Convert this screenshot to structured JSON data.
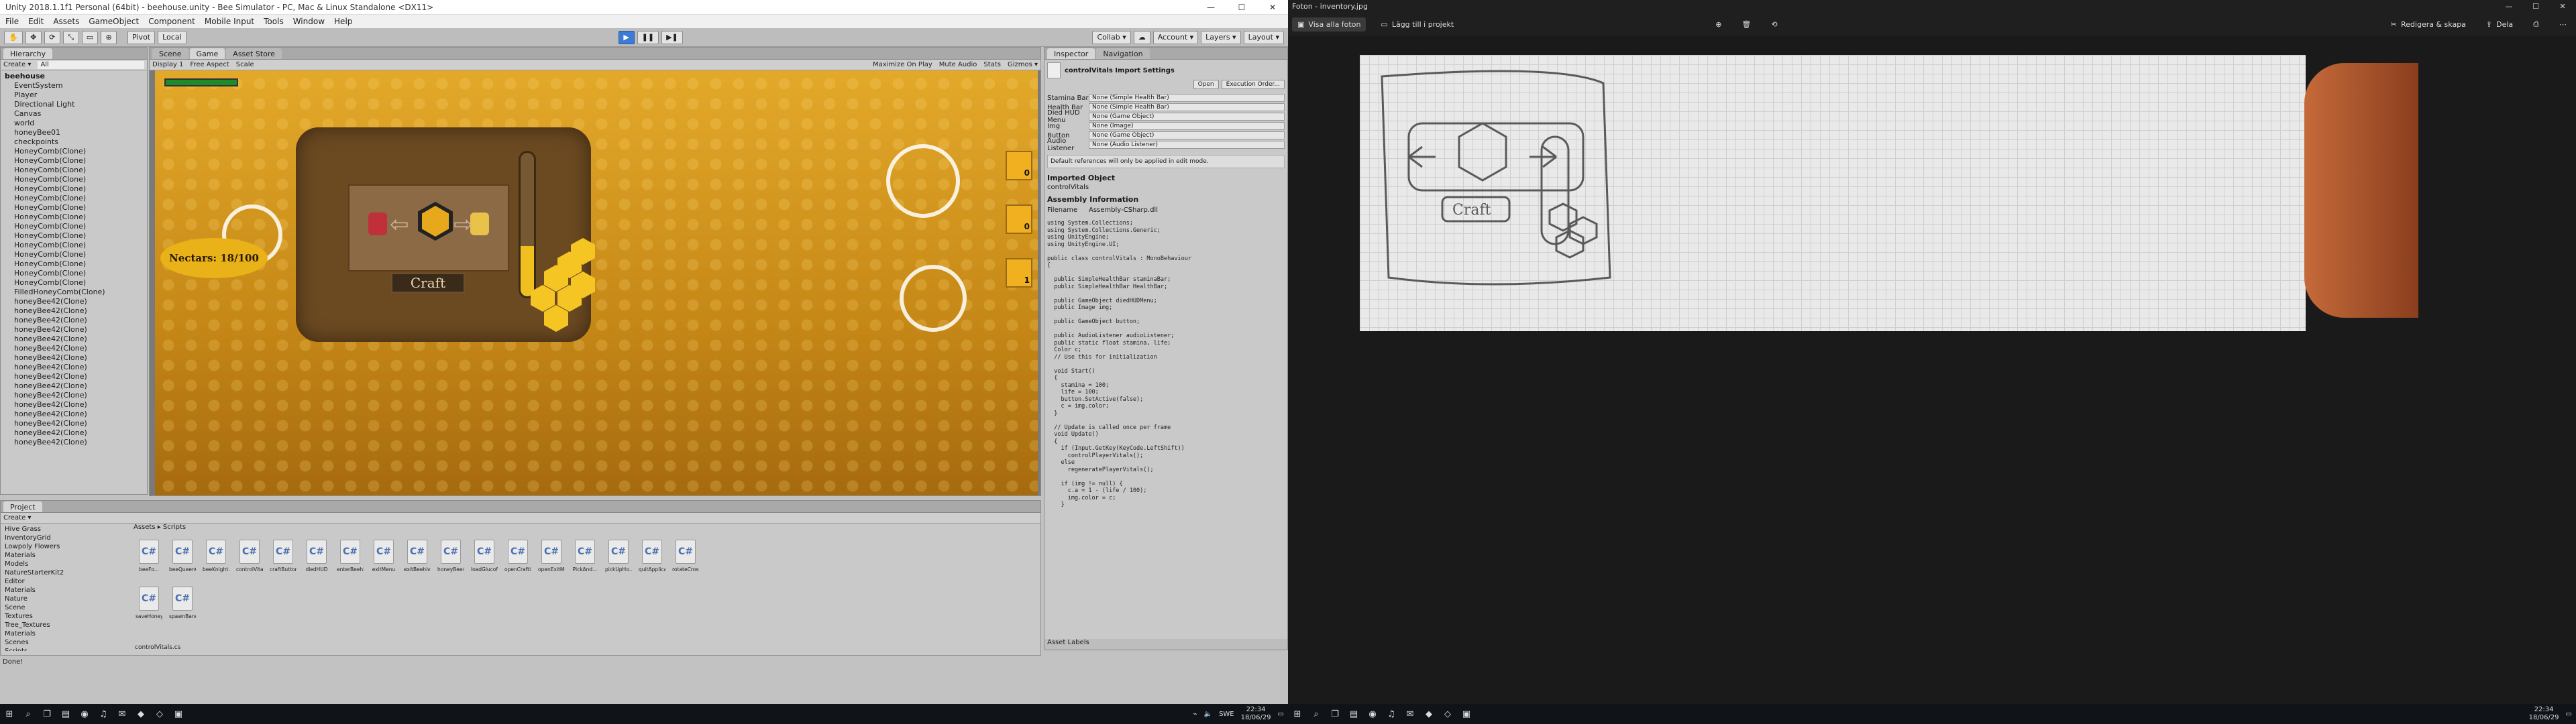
{
  "unity": {
    "title": "Unity 2018.1.1f1 Personal (64bit) - beehouse.unity - Bee Simulator - PC, Mac & Linux Standalone <DX11>",
    "menu": [
      "File",
      "Edit",
      "Assets",
      "GameObject",
      "Component",
      "Mobile Input",
      "Tools",
      "Window",
      "Help"
    ],
    "toolbar": {
      "pivot": "Pivot",
      "local": "Local",
      "collab": "Collab ▾",
      "account": "Account ▾",
      "layers": "Layers ▾",
      "layout": "Layout ▾"
    },
    "hierarchy": {
      "tab": "Hierarchy",
      "create": "Create ▾",
      "search": "All",
      "scene": "beehouse",
      "items": [
        "EventSystem",
        "Player",
        "Directional Light",
        "Canvas",
        "world",
        "honeyBee01",
        "checkpoints",
        "HoneyComb(Clone)",
        "HoneyComb(Clone)",
        "HoneyComb(Clone)",
        "HoneyComb(Clone)",
        "HoneyComb(Clone)",
        "HoneyComb(Clone)",
        "HoneyComb(Clone)",
        "HoneyComb(Clone)",
        "HoneyComb(Clone)",
        "HoneyComb(Clone)",
        "HoneyComb(Clone)",
        "HoneyComb(Clone)",
        "HoneyComb(Clone)",
        "HoneyComb(Clone)",
        "HoneyComb(Clone)",
        "FilledHoneyComb(Clone)",
        "honeyBee42(Clone)",
        "honeyBee42(Clone)",
        "honeyBee42(Clone)",
        "honeyBee42(Clone)",
        "honeyBee42(Clone)",
        "honeyBee42(Clone)",
        "honeyBee42(Clone)",
        "honeyBee42(Clone)",
        "honeyBee42(Clone)",
        "honeyBee42(Clone)",
        "honeyBee42(Clone)",
        "honeyBee42(Clone)",
        "honeyBee42(Clone)",
        "honeyBee42(Clone)",
        "honeyBee42(Clone)",
        "honeyBee42(Clone)"
      ]
    },
    "tabs": [
      "Scene",
      "Game",
      "Asset Store"
    ],
    "gamebar": {
      "display": "Display 1",
      "aspect": "Free Aspect",
      "scale": "Scale",
      "maximize": "Maximize On Play",
      "mute": "Mute Audio",
      "stats": "Stats",
      "gizmos": "Gizmos ▾"
    },
    "game": {
      "nectar": "Nectars: 18/100",
      "craft": "Craft",
      "slots": [
        "0",
        "0",
        "1"
      ],
      "tube_fill": 0.35
    },
    "inspector": {
      "tab": "Inspector",
      "tab2": "Navigation",
      "title": "controlVitals Import Settings",
      "open": "Open",
      "exec": "Execution Order...",
      "fields": [
        [
          "Stamina Bar",
          "None (Simple Health Bar)"
        ],
        [
          "Health Bar",
          "None (Simple Health Bar)"
        ],
        [
          "Died HUD Menu",
          "None (Game Object)"
        ],
        [
          "Img",
          "None (Image)"
        ],
        [
          "Button",
          "None (Game Object)"
        ],
        [
          "Audio Listener",
          "None (Audio Listener)"
        ]
      ],
      "note": "Default references will only be applied in edit mode.",
      "imported": "Imported Object",
      "objname": "controlVitals",
      "assembly": "Assembly Information",
      "filename_k": "Filename",
      "filename_v": "Assembly-CSharp.dll",
      "code": "using System.Collections;\nusing System.Collections.Generic;\nusing UnityEngine;\nusing UnityEngine.UI;\n\npublic class controlVitals : MonoBehaviour\n{\n\n  public SimpleHealthBar staminaBar;\n  public SimpleHealthBar HealthBar;\n\n  public GameObject diedHUDMenu;\n  public Image img;\n\n  public GameObject button;\n\n  public AudioListener audioListener;\n  public static float stamina, life;\n  Color c;\n  // Use this for initialization\n\n  void Start()\n  {\n    stamina = 100;\n    life = 100;\n    button.SetActive(false);\n    c = img.color;\n  }\n\n  // Update is called once per frame\n  void Update()\n  {\n    if (Input.GetKey(KeyCode.LeftShift))\n      controlPlayerVitals();\n    else\n      regeneratePlayerVitals();\n\n    if (img != null) {\n      c.a = 1 - (life / 100);\n      img.color = c;\n    }",
      "labels": "Asset Labels"
    },
    "project": {
      "tab": "Project",
      "create": "Create ▾",
      "folders": [
        "Hive Grass",
        "InventoryGrid",
        "Lowpoly Flowers",
        "Materials",
        "Models",
        "NatureStarterKit2",
        "Editor",
        "Materials",
        "Nature",
        "Scene",
        "Textures",
        "Tree_Textures",
        "Materials",
        "Scenes",
        "Scripts"
      ],
      "path": "Assets ▸ Scripts",
      "assets": [
        "beeFo...",
        "beeQueenC...",
        "beeKnight...",
        "controlVita...",
        "craftButton",
        "diedHUD",
        "enterBeehi...",
        "exitMenu",
        "exitBeehive",
        "honeyBee42",
        "loadGlucof...",
        "openCrafti...",
        "openExitMe...",
        "PickAnd...",
        "pickUpHo...",
        "quitApplicat...",
        "rotateCross",
        "saveHoney...",
        "spawnBand..."
      ],
      "footer": "controlVitals.cs"
    },
    "status": "Done!"
  },
  "taskbar_left": {
    "time": "22:34",
    "date": "18/06/29",
    "lang": "SWE"
  },
  "photos": {
    "title": "Foton - inventory.jpg",
    "view_all": "Visa alla foton",
    "add_to": "Lägg till i projekt",
    "edit": "Redigera & skapa",
    "share": "Dela"
  },
  "taskbar_right": {
    "time": "22:34",
    "date": "18/06/29"
  }
}
